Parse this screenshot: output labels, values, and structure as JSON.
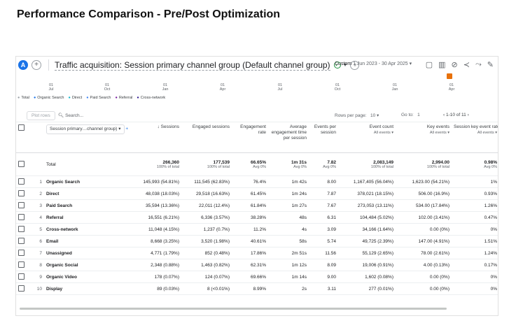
{
  "page_title": "Performance Comparison - Pre/Post Optimization",
  "header": {
    "avatar_letter": "A",
    "add_symbol": "+",
    "report_title": "Traffic acquisition: Session primary channel group (Default channel group)",
    "date_label": "Custom",
    "date_range": "1 Jun 2023 - 30 Apr 2025"
  },
  "axis": {
    "ticks": [
      {
        "day": "01",
        "mon": "Jul"
      },
      {
        "day": "01",
        "mon": "Oct"
      },
      {
        "day": "01",
        "mon": "Jan"
      },
      {
        "day": "01",
        "mon": "Apr"
      },
      {
        "day": "01",
        "mon": "Jul"
      },
      {
        "day": "01",
        "mon": "Oct"
      },
      {
        "day": "01",
        "mon": "Jan"
      },
      {
        "day": "01",
        "mon": "Apr"
      }
    ]
  },
  "legend": [
    {
      "label": "Total",
      "color": "#9aa0a6"
    },
    {
      "label": "Organic Search",
      "color": "#1a73e8"
    },
    {
      "label": "Direct",
      "color": "#12b5cb"
    },
    {
      "label": "Paid Search",
      "color": "#4285f4"
    },
    {
      "label": "Referral",
      "color": "#7b1fa2"
    },
    {
      "label": "Cross-network",
      "color": "#311b92"
    }
  ],
  "toolbar": {
    "plot_rows": "Plot rows",
    "search_placeholder": "Search...",
    "rows_per_page_label": "Rows per page:",
    "rows_per_page": "10",
    "goto_label": "Go to:",
    "goto_value": "1",
    "pager": "1-10 of 11"
  },
  "table": {
    "dimension_header": "Session primary…channel group)",
    "columns": [
      {
        "label": "Sessions",
        "sorted": true
      },
      {
        "label": "Engaged sessions"
      },
      {
        "label": "Engagement rate"
      },
      {
        "label": "Average engagement time per session"
      },
      {
        "label": "Events per session"
      },
      {
        "label": "Event count",
        "sub": "All events"
      },
      {
        "label": "Key events",
        "sub": "All events"
      },
      {
        "label": "Session key event rate",
        "sub": "All events"
      }
    ],
    "total": {
      "label": "Total",
      "values": [
        "266,360",
        "177,539",
        "66.65%",
        "1m 31s",
        "7.82",
        "2,083,149",
        "2,994.00",
        "0.98%"
      ],
      "subs": [
        "100% of total",
        "100% of total",
        "Avg 0%",
        "Avg 0%",
        "Avg 0%",
        "100% of total",
        "100% of total",
        "Avg 0%"
      ]
    },
    "rows": [
      {
        "n": "1",
        "name": "Organic Search",
        "values": [
          "145,993 (54.81%)",
          "111,545 (62.83%)",
          "76.4%",
          "1m 42s",
          "8.00",
          "1,167,405 (56.04%)",
          "1,623.00 (54.21%)",
          "1%"
        ]
      },
      {
        "n": "2",
        "name": "Direct",
        "values": [
          "48,038 (18.03%)",
          "29,518 (16.63%)",
          "61.45%",
          "1m 24s",
          "7.87",
          "378,021 (18.15%)",
          "506.00 (16.9%)",
          "0.93%"
        ]
      },
      {
        "n": "3",
        "name": "Paid Search",
        "values": [
          "35,594 (13.36%)",
          "22,011 (12.4%)",
          "61.84%",
          "1m 27s",
          "7.67",
          "273,053 (13.11%)",
          "534.00 (17.84%)",
          "1.26%"
        ]
      },
      {
        "n": "4",
        "name": "Referral",
        "values": [
          "16,551 (6.21%)",
          "6,336 (3.57%)",
          "38.28%",
          "48s",
          "6.31",
          "104,484 (5.02%)",
          "102.00 (3.41%)",
          "0.47%"
        ]
      },
      {
        "n": "5",
        "name": "Cross-network",
        "values": [
          "11,048 (4.15%)",
          "1,237 (0.7%)",
          "11.2%",
          "4s",
          "3.09",
          "34,166 (1.64%)",
          "0.00 (0%)",
          "0%"
        ]
      },
      {
        "n": "6",
        "name": "Email",
        "values": [
          "8,668 (3.25%)",
          "3,520 (1.98%)",
          "40.61%",
          "58s",
          "5.74",
          "49,725 (2.39%)",
          "147.00 (4.91%)",
          "1.51%"
        ]
      },
      {
        "n": "7",
        "name": "Unassigned",
        "values": [
          "4,771 (1.79%)",
          "852 (0.48%)",
          "17.86%",
          "2m 51s",
          "11.56",
          "55,129 (2.65%)",
          "78.00 (2.61%)",
          "1.24%"
        ]
      },
      {
        "n": "8",
        "name": "Organic Social",
        "values": [
          "2,348 (0.88%)",
          "1,463 (0.82%)",
          "62.31%",
          "1m 12s",
          "8.09",
          "19,006 (0.91%)",
          "4.00 (0.13%)",
          "0.17%"
        ]
      },
      {
        "n": "9",
        "name": "Organic Video",
        "values": [
          "178 (0.07%)",
          "124 (0.07%)",
          "69.66%",
          "1m 14s",
          "9.00",
          "1,602 (0.08%)",
          "0.00 (0%)",
          "0%"
        ]
      },
      {
        "n": "10",
        "name": "Display",
        "values": [
          "89 (0.03%)",
          "8 (<0.01%)",
          "8.99%",
          "2s",
          "3.11",
          "277 (0.01%)",
          "0.00 (0%)",
          "0%"
        ]
      }
    ]
  }
}
